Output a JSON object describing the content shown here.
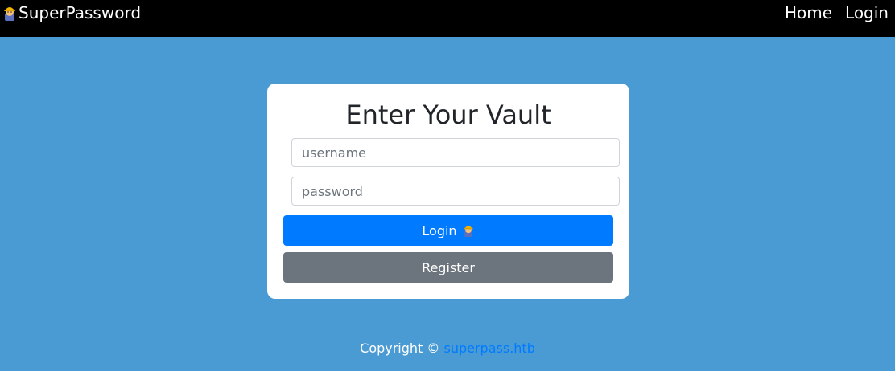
{
  "navbar": {
    "brand_icon": "worker-emoji-icon",
    "brand_label": "SuperPassword",
    "links": [
      {
        "label": "Home"
      },
      {
        "label": "Login"
      }
    ]
  },
  "login_card": {
    "title": "Enter Your Vault",
    "username_placeholder": "username",
    "username_value": "",
    "password_placeholder": "password",
    "password_value": "",
    "login_button_label": "Login",
    "login_button_icon": "worker-emoji-icon",
    "register_button_label": "Register"
  },
  "footer": {
    "copyright_text": "Copyright ©",
    "link_text": "superpass.htb"
  },
  "colors": {
    "background": "#4a9bd4",
    "navbar": "#000000",
    "primary": "#007bff",
    "secondary": "#6c757d"
  }
}
